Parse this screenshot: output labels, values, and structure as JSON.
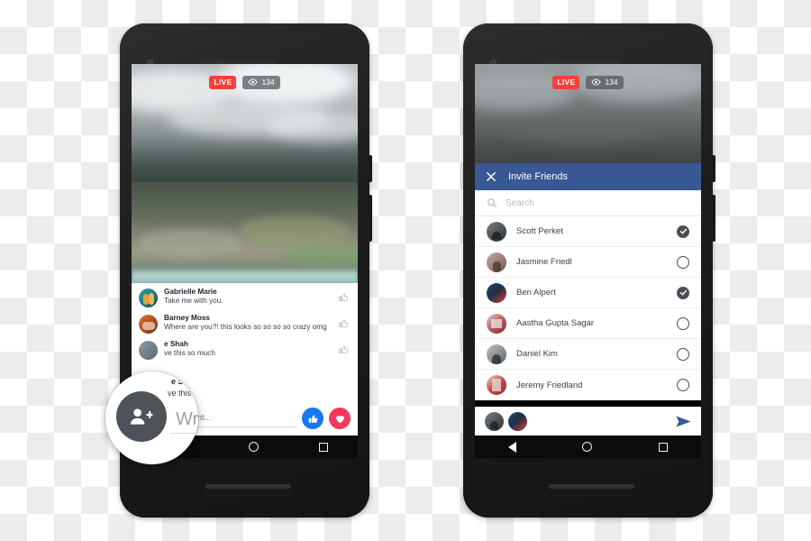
{
  "theme": {
    "live_red": "#fc3d39",
    "facebook_blue": "#3a5896",
    "like_blue": "#1778f2",
    "love_red": "#f5385d",
    "phone_body": "#1c1c1c",
    "checkmark_gray": "#4b4f54"
  },
  "left_phone": {
    "name": "facebook-live-viewer-phone",
    "stream": {
      "live_label": "LIVE",
      "viewer_count": "134",
      "eye_icon": "eye-icon",
      "live_badge_icon": "live-badge"
    },
    "comments": [
      {
        "author": "Gabrielle Marie",
        "text": "Take me with you.",
        "like_icon": "thumbs-up-outline-icon",
        "avatar": "avatar-gabrielle-marie"
      },
      {
        "author": "Barney Moss",
        "text": "Where are you?! this looks so so so so crazy omg",
        "like_icon": "thumbs-up-outline-icon",
        "avatar": "avatar-barney-moss"
      },
      {
        "author": "e Shah",
        "text": "ve this so much",
        "like_icon": "thumbs-up-outline-icon",
        "avatar": "avatar-shah"
      }
    ],
    "composer": {
      "placeholder": "Write a comment...",
      "value": "",
      "like_reaction_icon": "thumbs-up-filled-icon",
      "love_reaction_icon": "heart-filled-icon"
    },
    "navbar": {
      "home_icon": "home-circle-icon",
      "recents_icon": "recents-square-icon"
    }
  },
  "magnifier": {
    "name": "magnifier-loupe",
    "fab_icon": "add-person-icon",
    "visible_text_a": "e Shah",
    "visible_text_b": "ve this so much",
    "visible_text_c": "Wr"
  },
  "right_phone": {
    "name": "invite-friends-phone",
    "stream": {
      "live_label": "LIVE",
      "viewer_count": "134",
      "eye_icon": "eye-icon"
    },
    "sheet": {
      "close_icon": "close-x-icon",
      "title": "Invite Friends",
      "search": {
        "placeholder": "Search",
        "value": "",
        "icon": "search-icon"
      },
      "friends": [
        {
          "name": "Scott Perket",
          "selected": true,
          "avatar": "avatar-scott-perket"
        },
        {
          "name": "Jasmine Friedl",
          "selected": false,
          "avatar": "avatar-jasmine-friedl"
        },
        {
          "name": "Ben Alpert",
          "selected": true,
          "avatar": "avatar-ben-alpert"
        },
        {
          "name": "Aastha Gupta Sagar",
          "selected": false,
          "avatar": "avatar-aastha-gupta-sagar"
        },
        {
          "name": "Daniel Kim",
          "selected": false,
          "avatar": "avatar-daniel-kim"
        },
        {
          "name": "Jeremy Friedland",
          "selected": false,
          "avatar": "avatar-jeremy-friedland"
        }
      ],
      "send_bar": {
        "selected_avatars": [
          "avatar-scott-perket",
          "avatar-ben-alpert"
        ],
        "send_icon": "send-paper-plane-icon"
      }
    },
    "navbar": {
      "back_icon": "back-triangle-icon",
      "home_icon": "home-circle-icon",
      "recents_icon": "recents-square-icon"
    }
  }
}
